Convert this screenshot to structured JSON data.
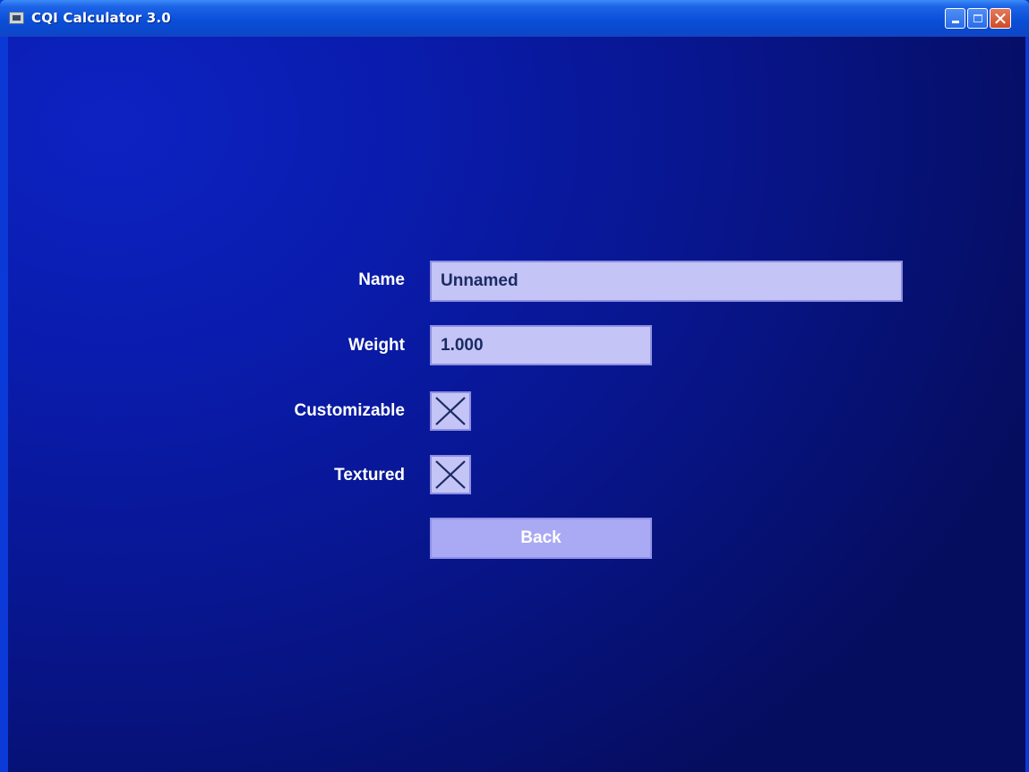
{
  "window": {
    "title": "CQI Calculator 3.0",
    "minimize_icon": "minimize-icon",
    "maximize_icon": "maximize-icon",
    "close_icon": "close-icon",
    "close_glyph": "✕"
  },
  "form": {
    "name": {
      "label": "Name",
      "value": "Unnamed"
    },
    "weight": {
      "label": "Weight",
      "value": "1.000"
    },
    "customizable": {
      "label": "Customizable",
      "checked": true
    },
    "textured": {
      "label": "Textured",
      "checked": true
    },
    "back_label": "Back"
  },
  "colors": {
    "background": "#0a1cad",
    "field_fill": "#c4c4f6",
    "button_fill": "#a9a9f4",
    "field_text": "#1b2b63"
  }
}
